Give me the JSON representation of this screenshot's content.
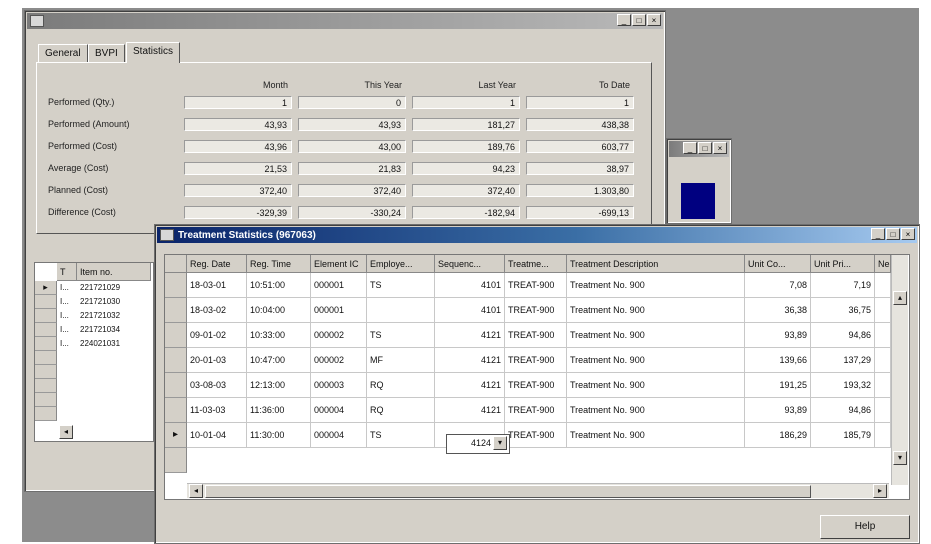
{
  "statistics_window": {
    "title": "",
    "tabs": [
      "General",
      "BVPI",
      "Statistics"
    ],
    "columns": [
      "Month",
      "This Year",
      "Last Year",
      "To Date"
    ],
    "rows": [
      {
        "label": "Performed (Qty.)",
        "values": [
          "1",
          "0",
          "1",
          "1"
        ]
      },
      {
        "label": "Performed (Amount)",
        "values": [
          "43,93",
          "43,93",
          "181,27",
          "438,38"
        ]
      },
      {
        "label": "Performed (Cost)",
        "values": [
          "43,96",
          "43,00",
          "189,76",
          "603,77"
        ]
      },
      {
        "label": "Average (Cost)",
        "values": [
          "21,53",
          "21,83",
          "94,23",
          "38,97"
        ]
      },
      {
        "label": "Planned (Cost)",
        "values": [
          "372,40",
          "372,40",
          "372,40",
          "1.303,80"
        ]
      },
      {
        "label": "Difference (Cost)",
        "values": [
          "-329,39",
          "-330,24",
          "-182,94",
          "-699,13"
        ]
      }
    ]
  },
  "item_list": {
    "headers": [
      "T",
      "Item no."
    ],
    "rows": [
      {
        "t": "I...",
        "item": "221721029"
      },
      {
        "t": "I...",
        "item": "221721030"
      },
      {
        "t": "I...",
        "item": "221721032"
      },
      {
        "t": "I...",
        "item": "221721034"
      },
      {
        "t": "I...",
        "item": "224021031"
      }
    ]
  },
  "small_window": {
    "title": ""
  },
  "treatment_window": {
    "title": "Treatment Statistics (967063)",
    "headers": [
      "Reg. Date",
      "Reg. Time",
      "Element IC",
      "Employe...",
      "Sequenc...",
      "Treatme...",
      "Treatment Description",
      "Unit Co...",
      "Unit Pri...",
      "Ne"
    ],
    "rows": [
      {
        "date": "18-03-01",
        "time": "10:51:00",
        "element": "000001",
        "employee": "TS",
        "seq": "4101",
        "treatment": "TREAT-900",
        "desc": "Treatment No. 900",
        "unit_cost": "7,08",
        "unit_price": "7,19"
      },
      {
        "date": "18-03-02",
        "time": "10:04:00",
        "element": "000001",
        "employee": "",
        "seq": "4101",
        "treatment": "TREAT-900",
        "desc": "Treatment No. 900",
        "unit_cost": "36,38",
        "unit_price": "36,75"
      },
      {
        "date": "09-01-02",
        "time": "10:33:00",
        "element": "000002",
        "employee": "TS",
        "seq": "4121",
        "treatment": "TREAT-900",
        "desc": "Treatment No. 900",
        "unit_cost": "93,89",
        "unit_price": "94,86"
      },
      {
        "date": "20-01-03",
        "time": "10:47:00",
        "element": "000002",
        "employee": "MF",
        "seq": "4121",
        "treatment": "TREAT-900",
        "desc": "Treatment No. 900",
        "unit_cost": "139,66",
        "unit_price": "137,29"
      },
      {
        "date": "03-08-03",
        "time": "12:13:00",
        "element": "000003",
        "employee": "RQ",
        "seq": "4121",
        "treatment": "TREAT-900",
        "desc": "Treatment No. 900",
        "unit_cost": "191,25",
        "unit_price": "193,32"
      },
      {
        "date": "11-03-03",
        "time": "11:36:00",
        "element": "000004",
        "employee": "RQ",
        "seq": "4121",
        "treatment": "TREAT-900",
        "desc": "Treatment No. 900",
        "unit_cost": "93,89",
        "unit_price": "94,86"
      },
      {
        "date": "10-01-04",
        "time": "11:30:00",
        "element": "000004",
        "employee": "TS",
        "seq": "4124",
        "treatment": "TREAT-900",
        "desc": "Treatment No. 900",
        "unit_cost": "186,29",
        "unit_price": "185,79"
      }
    ],
    "help_label": "Help"
  },
  "colors": {
    "title_active": "#0a246a",
    "title_inactive": "#7b7b7b",
    "window_face": "#d4d0c8",
    "desktop": "#8c8c8c",
    "navy_block": "#000080"
  }
}
